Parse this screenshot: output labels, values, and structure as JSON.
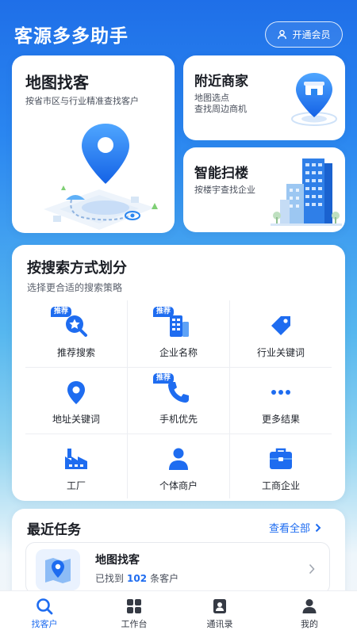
{
  "header": {
    "title": "客源多多助手",
    "vip_label": "开通会员"
  },
  "cards": {
    "map": {
      "title": "地图找客",
      "desc": "按省市区与行业精准查找客户"
    },
    "nearby": {
      "title": "附近商家",
      "desc_line1": "地图选点",
      "desc_line2": "查找周边商机"
    },
    "scan": {
      "title": "智能扫楼",
      "desc": "按楼宇查找企业"
    }
  },
  "search_panel": {
    "title": "按搜索方式划分",
    "subtitle": "选择更合适的搜索策略",
    "badge_text": "推荐",
    "items": [
      {
        "label": "推荐搜索",
        "icon": "star-search-icon",
        "badge": true
      },
      {
        "label": "企业名称",
        "icon": "building-icon",
        "badge": true
      },
      {
        "label": "行业关键词",
        "icon": "tag-icon",
        "badge": false
      },
      {
        "label": "地址关键词",
        "icon": "location-pin-icon",
        "badge": false
      },
      {
        "label": "手机优先",
        "icon": "phone-icon",
        "badge": true
      },
      {
        "label": "更多结果",
        "icon": "more-dots-icon",
        "badge": false
      },
      {
        "label": "工厂",
        "icon": "factory-icon",
        "badge": false
      },
      {
        "label": "个体商户",
        "icon": "person-icon",
        "badge": false
      },
      {
        "label": "工商企业",
        "icon": "briefcase-icon",
        "badge": false
      }
    ]
  },
  "tasks": {
    "title": "最近任务",
    "view_all": "查看全部",
    "item": {
      "name": "地图找客",
      "status_prefix": "已找到",
      "count": "102",
      "status_suffix": "条客户"
    }
  },
  "tabbar": [
    {
      "label": "找客户",
      "icon": "search-icon",
      "active": true
    },
    {
      "label": "工作台",
      "icon": "grid-icon",
      "active": false
    },
    {
      "label": "通讯录",
      "icon": "contacts-icon",
      "active": false
    },
    {
      "label": "我的",
      "icon": "user-icon",
      "active": false
    }
  ],
  "colors": {
    "accent": "#1e6cf0",
    "header_bg": "#1f6fe8"
  }
}
